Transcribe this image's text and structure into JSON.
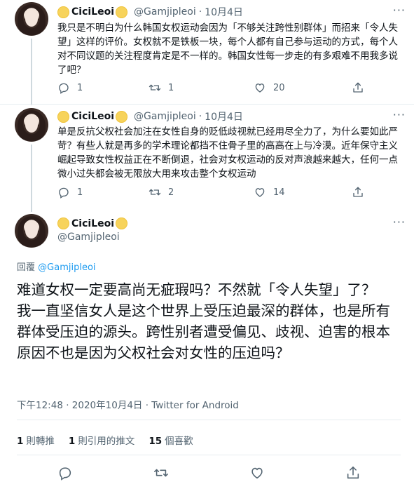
{
  "tweets": [
    {
      "name": "CiciLeoi",
      "handle": "@Gamjipleoi",
      "dot": "·",
      "date": "10月4日",
      "more": "···",
      "text": "我只是不明白为什么韩国女权运动会因为「不够关注跨性别群体」而招来「令人失望」这样的评价。女权就不是铁板一块，每个人都有自己参与运动的方式，每个人对不同议题的关注程度肯定是不一样的。韩国女性每一步走的有多艰难不用我多说了吧？",
      "replies": "1",
      "retweets": "1",
      "likes": "20"
    },
    {
      "name": "CiciLeoi",
      "handle": "@Gamjipleoi",
      "dot": "·",
      "date": "10月4日",
      "more": "···",
      "text": "单是反抗父权社会加注在女性自身的贬低歧视就已经用尽全力了，为什么要如此严苛？有些人就是再多的学术理论都挡不住骨子里的高高在上与冷漠。近年保守主义崛起导致女性权益正在不断倒退，社会对女权运动的反对声浪越来越大，任何一点微小过失都会被无限放大用来攻击整个女权运动",
      "replies": "1",
      "retweets": "2",
      "likes": "14"
    }
  ],
  "main_tweet": {
    "name": "CiciLeoi",
    "handle": "@Gamjipleoi",
    "more": "···",
    "reply_prefix": "回覆",
    "reply_mention": "@Gamjipleoi",
    "text_line1": "难道女权一定要高尚无疵瑕吗？不然就「令人失望」了？",
    "text_line2": "我一直坚信女人是这个世界上受压迫最深的群体，也是所有群体受压迫的源头。跨性别者遭受偏见、歧视、迫害的根本原因不也是因为父权社会对女性的压迫吗？",
    "meta": "下午12:48 · 2020年10月4日 · Twitter for Android",
    "retweet_count": "1",
    "retweet_label": "則轉推",
    "quote_count": "1",
    "quote_label": "則引用的推文",
    "like_count": "15",
    "like_label": "個喜歡"
  },
  "icons": [
    "reply-icon",
    "retweet-icon",
    "like-icon",
    "share-icon",
    "sun-emoji-icon",
    "more-icon"
  ],
  "colors": {
    "link": "#1d9bf0",
    "secondary": "#536471",
    "divider": "#e6ecf0",
    "thread_line": "#cfd9de"
  }
}
